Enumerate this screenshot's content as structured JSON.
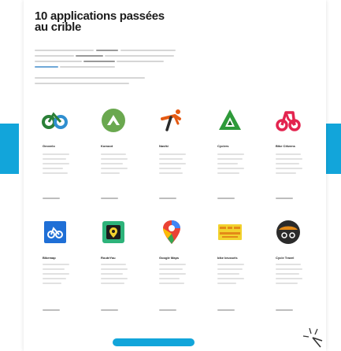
{
  "document": {
    "title_line1": "10 applications passées",
    "title_line2": "au crible"
  },
  "apps": [
    {
      "name": "Geovelo",
      "icon": "geovelo-bike-icon",
      "color": "#2f8fd0"
    },
    {
      "name": "Komoot",
      "icon": "komoot-icon",
      "color": "#6aa84f"
    },
    {
      "name": "Naviki",
      "icon": "naviki-cyclist-icon",
      "color": "#e55a12"
    },
    {
      "name": "Cyclers",
      "icon": "cyclers-icon",
      "color": "#2e9a3a"
    },
    {
      "name": "Bike Citizens",
      "icon": "bike-citizens-icon",
      "color": "#e3244f"
    },
    {
      "name": "Bikemap",
      "icon": "bikemap-icon",
      "color": "#1f6fd6"
    },
    {
      "name": "RouteYou",
      "icon": "routeyou-icon",
      "color": "#2db37a"
    },
    {
      "name": "Google Maps",
      "icon": "google-maps-pin-icon",
      "color": "#ea4335"
    },
    {
      "name": "bike brussels",
      "icon": "bike-for-brussels-icon",
      "color": "#f2d22e"
    },
    {
      "name": "Cycle Travel",
      "icon": "cycle-travel-icon",
      "color": "#2b2b2b"
    }
  ],
  "colors": {
    "accent": "#12a5da"
  }
}
